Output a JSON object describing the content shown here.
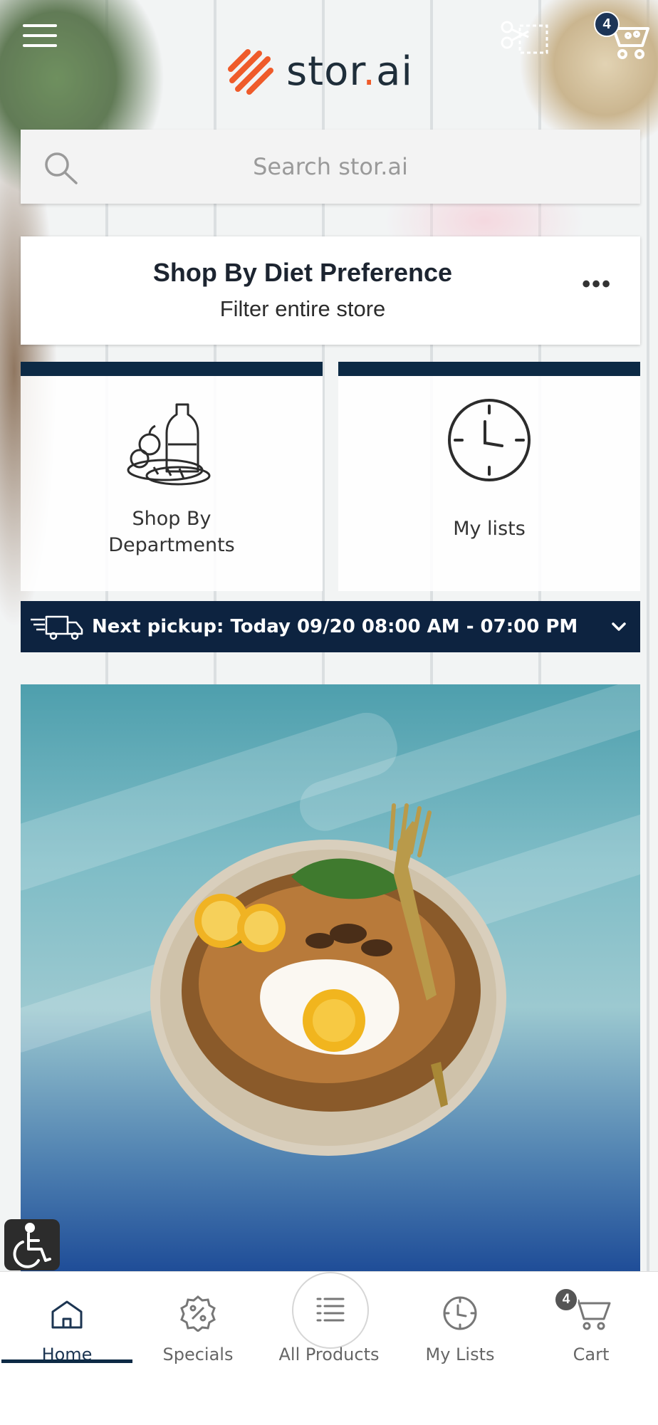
{
  "header": {
    "menu_icon": "hamburger-icon",
    "logo_text_main": "stor",
    "logo_text_dot": ".",
    "logo_text_end": "ai",
    "coupon_icon": "scissors-coupon-icon",
    "cart_icon": "cart-icon",
    "cart_count": "4"
  },
  "search": {
    "placeholder": "Search stor.ai",
    "icon": "search-icon"
  },
  "diet": {
    "title": "Shop By Diet Preference",
    "subtitle": "Filter entire store",
    "more": "•••"
  },
  "tiles": [
    {
      "label": "Shop By Departments",
      "label_line1": "Shop By",
      "label_line2": "Departments",
      "icon": "groceries-icon"
    },
    {
      "label": "My lists",
      "icon": "clock-icon"
    }
  ],
  "pickup": {
    "text": "Next pickup: Today 09/20 08:00 AM - 07:00 PM",
    "icon": "delivery-truck-icon"
  },
  "colors": {
    "accent_orange": "#ef5b2a",
    "navy": "#0d2a45",
    "pickup_bar": "#0d2340"
  },
  "bottom_nav": {
    "items": [
      {
        "label": "Home",
        "icon": "home-icon",
        "active": true
      },
      {
        "label": "Specials",
        "icon": "percent-badge-icon"
      },
      {
        "label": "All Products",
        "icon": "list-icon"
      },
      {
        "label": "My Lists",
        "icon": "clock-icon"
      },
      {
        "label": "Cart",
        "icon": "cart-icon",
        "badge": "4"
      }
    ]
  }
}
